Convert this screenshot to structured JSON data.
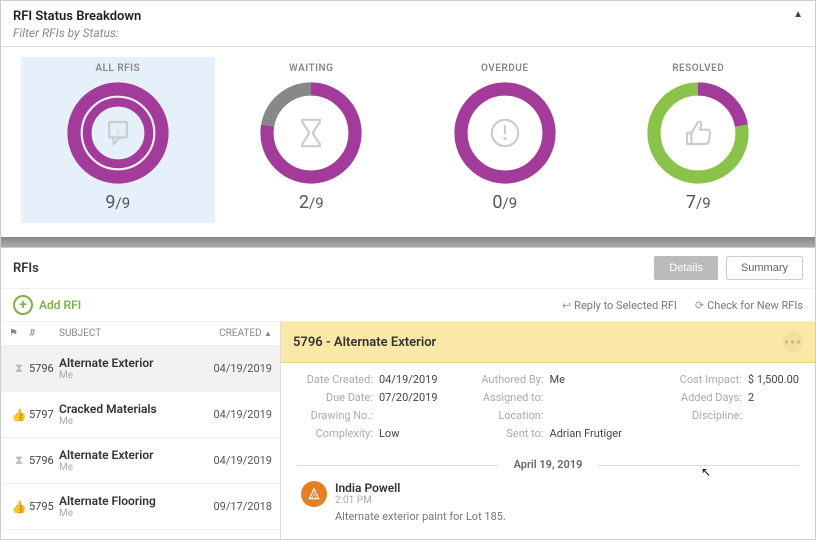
{
  "header": {
    "title": "RFI Status Breakdown",
    "filter_sub": "Filter RFIs by Status:"
  },
  "donuts": {
    "all": {
      "label": "ALL RFIS",
      "count": "9",
      "total": "/9"
    },
    "waiting": {
      "label": "WAITING",
      "count": "2",
      "total": "/9"
    },
    "overdue": {
      "label": "OVERDUE",
      "count": "0",
      "total": "/9"
    },
    "resolved": {
      "label": "RESOLVED",
      "count": "7",
      "total": "/9"
    }
  },
  "rfis": {
    "section_title": "RFIs",
    "tabs": {
      "details": "Details",
      "summary": "Summary"
    },
    "toolbar": {
      "add": "Add RFI",
      "reply": "Reply to Selected RFI",
      "check": "Check for New RFIs"
    },
    "columns": {
      "num": "#",
      "subject": "SUBJECT",
      "created": "CREATED"
    },
    "rows": [
      {
        "icon": "hourglass",
        "num": "5796",
        "subject": "Alternate Exterior",
        "author": "Me",
        "created": "04/19/2019"
      },
      {
        "icon": "thumb",
        "num": "5797",
        "subject": "Cracked Materials",
        "author": "Me",
        "created": "04/19/2019"
      },
      {
        "icon": "hourglass",
        "num": "5796",
        "subject": "Alternate Exterior",
        "author": "Me",
        "created": "04/19/2019"
      },
      {
        "icon": "thumb",
        "num": "5795",
        "subject": "Alternate Flooring",
        "author": "Me",
        "created": "09/17/2018"
      }
    ]
  },
  "detail": {
    "title": "5796 - Alternate Exterior",
    "labels": {
      "date_created": "Date Created:",
      "due_date": "Due Date:",
      "drawing_no": "Drawing No.:",
      "complexity": "Complexity:",
      "authored_by": "Authored By:",
      "assigned_to": "Assigned to:",
      "location": "Location:",
      "sent_to": "Sent to:",
      "cost_impact": "Cost Impact:",
      "added_days": "Added Days:",
      "discipline": "Discipline:"
    },
    "values": {
      "date_created": "04/19/2019",
      "due_date": "07/20/2019",
      "drawing_no": "",
      "complexity": "Low",
      "authored_by": "Me",
      "assigned_to": "",
      "location": "",
      "sent_to": "Adrian Frutiger",
      "cost_impact": "$ 1,500.00",
      "added_days": "2",
      "discipline": ""
    },
    "timeline_date": "April 19, 2019",
    "comment": {
      "author": "India Powell",
      "time": "2:01 PM",
      "text": "Alternate exterior paint for Lot 185."
    }
  }
}
